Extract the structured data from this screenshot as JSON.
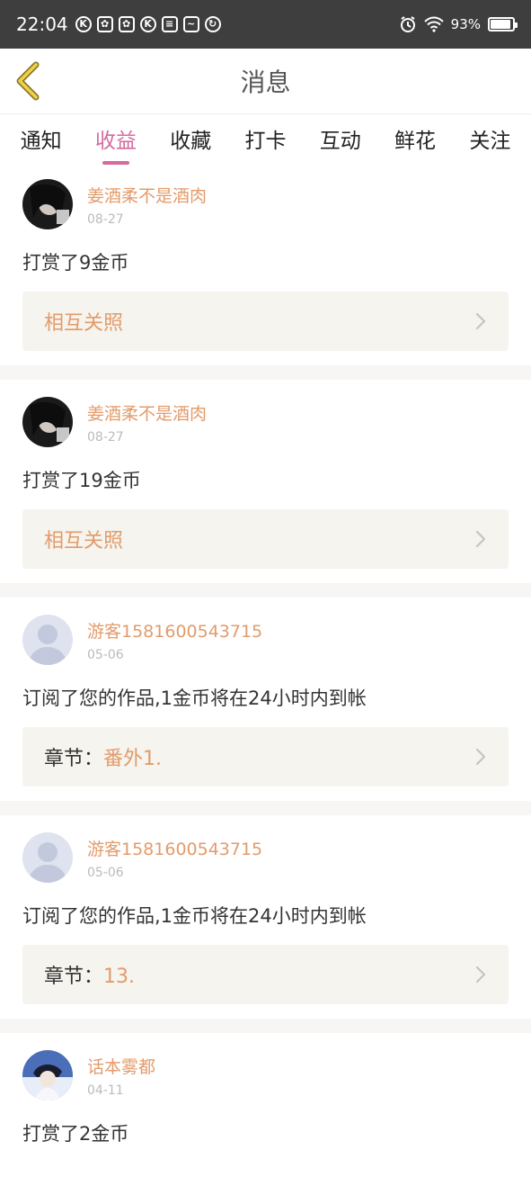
{
  "statusbar": {
    "time": "22:04",
    "battery": "93%",
    "battery_level": 0.93
  },
  "header": {
    "title": "消息"
  },
  "tabs": [
    {
      "label": "通知",
      "active": false
    },
    {
      "label": "收益",
      "active": true
    },
    {
      "label": "收藏",
      "active": false
    },
    {
      "label": "打卡",
      "active": false
    },
    {
      "label": "互动",
      "active": false
    },
    {
      "label": "鲜花",
      "active": false
    },
    {
      "label": "关注",
      "active": false
    }
  ],
  "messages": [
    {
      "user": "姜酒柔不是酒肉",
      "date": "08-27",
      "text": "打赏了9金币",
      "ref_prefix": "",
      "ref": "相互关照"
    },
    {
      "user": "姜酒柔不是酒肉",
      "date": "08-27",
      "text": "打赏了19金币",
      "ref_prefix": "",
      "ref": "相互关照"
    },
    {
      "user": "游客1581600543715",
      "date": "05-06",
      "text": "订阅了您的作品,1金币将在24小时内到帐",
      "ref_prefix": "章节：",
      "ref": "番外1."
    },
    {
      "user": "游客1581600543715",
      "date": "05-06",
      "text": "订阅了您的作品,1金币将在24小时内到帐",
      "ref_prefix": "章节：",
      "ref": "13."
    },
    {
      "user": "话本雾都",
      "date": "04-11",
      "text": "打赏了2金币",
      "ref_prefix": "",
      "ref": ""
    }
  ],
  "colors": {
    "accent": "#d66aa0",
    "name": "#e39b6a",
    "statusbar": "#3e3e3e"
  }
}
